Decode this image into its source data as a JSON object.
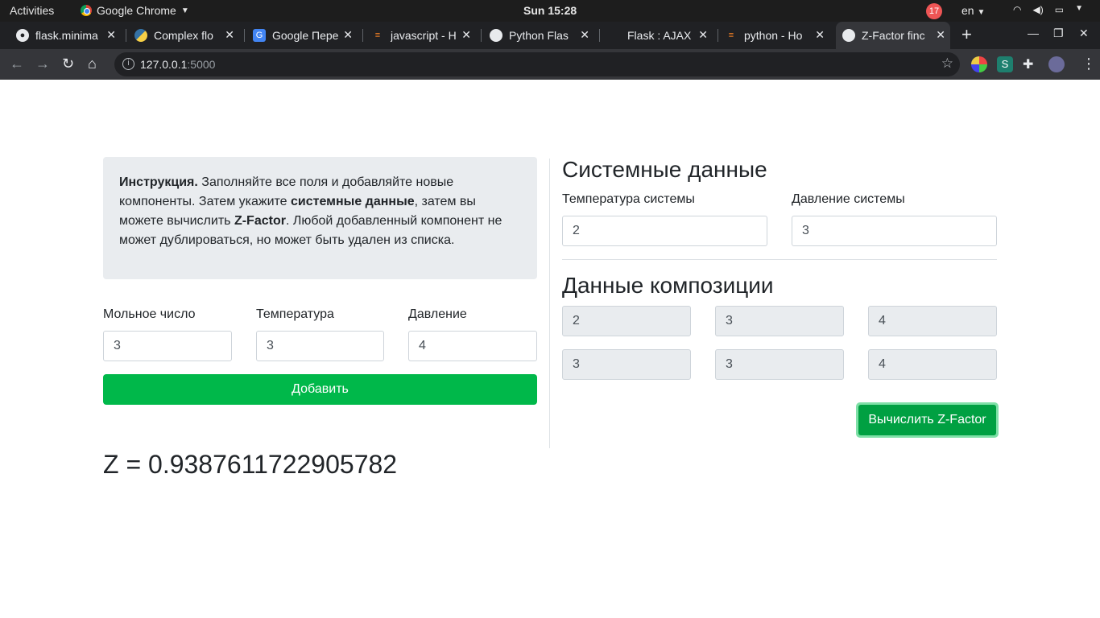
{
  "os": {
    "activities": "Activities",
    "app_menu": "Google Chrome",
    "clock": "Sun 15:28",
    "notification_count": "17",
    "language": "en"
  },
  "browser": {
    "tabs": [
      {
        "title": "flask.minima",
        "icon": "github-icon"
      },
      {
        "title": "Complex flo",
        "icon": "python-icon"
      },
      {
        "title": "Google Пере",
        "icon": "google-translate-icon"
      },
      {
        "title": "javascript - H",
        "icon": "stackoverflow-icon"
      },
      {
        "title": "Python Flas",
        "icon": "globe-icon"
      },
      {
        "title": "Flask : AJAX",
        "icon": "blank-icon"
      },
      {
        "title": "python - Ho",
        "icon": "stackoverflow-icon"
      },
      {
        "title": "Z-Factor finc",
        "icon": "globe-icon",
        "active": true
      }
    ],
    "url_host": "127.0.0.1",
    "url_port": ":5000"
  },
  "instructions": {
    "lead": "Инструкция.",
    "text1": " Заполняйте все поля и добавляйте новые компоненты. Затем укажите ",
    "bold1": "системные данные",
    "text2": ", затем вы можете вычислить ",
    "bold2": "Z-Factor",
    "text3": ". Любой добавленный компонент не может дублироваться, но может быть удален из списка."
  },
  "component_form": {
    "molar_label": "Мольное число",
    "molar_value": "3",
    "temp_label": "Температура",
    "temp_value": "3",
    "pressure_label": "Давление",
    "pressure_value": "4",
    "add_button": "Добавить"
  },
  "result": "Z = 0.9387611722905782",
  "system": {
    "heading": "Системные данные",
    "temp_label": "Температура системы",
    "temp_value": "2",
    "pressure_label": "Давление системы",
    "pressure_value": "3"
  },
  "composition": {
    "heading": "Данные композиции",
    "rows": [
      [
        "2",
        "3",
        "4"
      ],
      [
        "3",
        "3",
        "4"
      ]
    ]
  },
  "calc_button": "Вычислить Z-Factor"
}
